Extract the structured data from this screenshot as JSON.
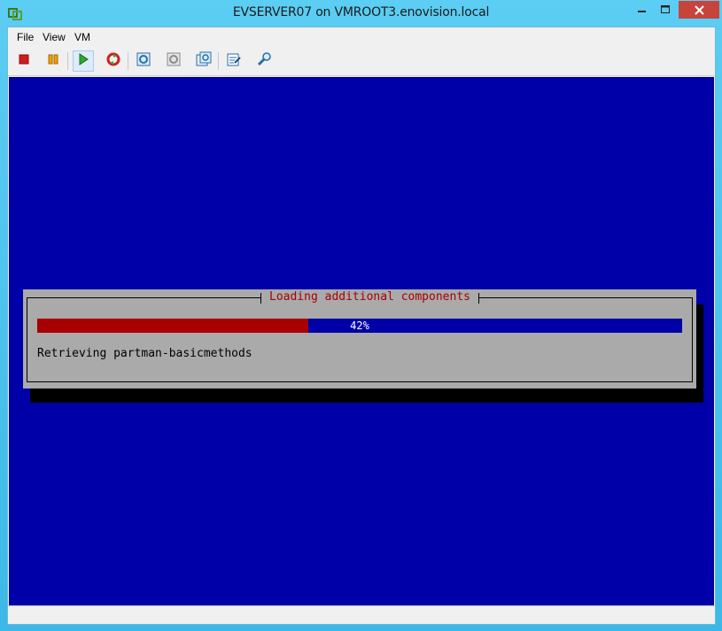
{
  "window": {
    "title": "EVSERVER07 on VMROOT3.enovision.local",
    "accent_color": "#50c7f0"
  },
  "menu": {
    "file": "File",
    "view": "View",
    "vm": "VM"
  },
  "toolbar": {
    "buttons": [
      {
        "name": "power-off",
        "icon": "red-square-icon"
      },
      {
        "name": "pause",
        "icon": "pause-icon"
      },
      {
        "name": "power-on",
        "icon": "play-icon"
      },
      {
        "name": "reset",
        "icon": "reset-icon"
      },
      {
        "name": "snapshot",
        "icon": "snapshot-icon"
      },
      {
        "name": "revert",
        "icon": "revert-icon"
      },
      {
        "name": "snapshot-manager",
        "icon": "snapshot-manager-icon"
      },
      {
        "name": "edit-settings",
        "icon": "edit-settings-icon"
      },
      {
        "name": "tools",
        "icon": "tools-icon"
      }
    ]
  },
  "console": {
    "background_color": "#0000a8",
    "dialog": {
      "title": "Loading additional components",
      "progress_label": "42%",
      "progress_value": 0.42,
      "status_text": "Retrieving partman-basicmethods"
    }
  }
}
